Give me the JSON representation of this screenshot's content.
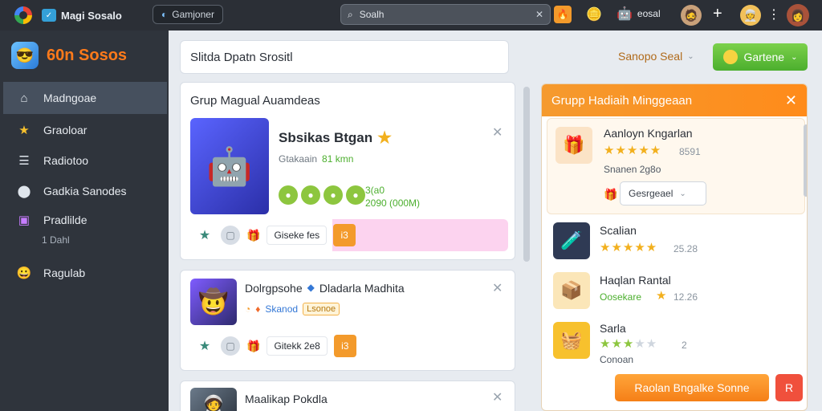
{
  "topbar": {
    "app_title": "Magi Sosalo",
    "tab_label": "Gamjoner",
    "search_value": "Soalh",
    "profile_label": "eosal"
  },
  "sidebar": {
    "brand_name": "60n Sosos",
    "items": [
      {
        "label": "Madngoae",
        "icon": "home-icon",
        "active": true
      },
      {
        "label": "Graoloar",
        "icon": "star-icon"
      },
      {
        "label": "Radiotoo",
        "icon": "list-icon"
      },
      {
        "label": "Gadkia Sanodes",
        "icon": "location-icon"
      },
      {
        "label": "Pradlilde",
        "icon": "gamepad-icon",
        "sub": "1 Dahl"
      },
      {
        "label": "Ragulab",
        "icon": "emoji-icon"
      }
    ]
  },
  "main": {
    "header": "Slitda Dpatn Srositl",
    "group_title": "Grup Magual Auamdeas",
    "cards": [
      {
        "title": "Sbsikas Btgan",
        "subtitle": "Gtakaain",
        "subtitle_accent": "81 kmn",
        "stat1": "3(a0",
        "stat2": "2090 (000M)",
        "tag": "Giseke fes",
        "button": "i3"
      },
      {
        "title": "Dolrgpsohe",
        "title2": "Dladarla Madhita",
        "meta": "Skanod",
        "tag_badge": "Lsonoe",
        "tag": "Gitekk 2e8",
        "button": "i3"
      },
      {
        "title": "Maalikap Pokdla"
      }
    ]
  },
  "right": {
    "filter_label": "Sanopo Seal",
    "green_button": "Gartene",
    "panel_title": "Grupp Hadiaih Minggeaan",
    "rewards": [
      {
        "name": "Aanloyn Kngarlan",
        "value": "8591",
        "sub": "Snanen 2g8o",
        "stars": 5
      },
      {
        "name": "Scalian",
        "value": "25.28",
        "stars": 5
      },
      {
        "name": "Haqlan Rantal",
        "value": "12.26",
        "sub_green": "Oosekare"
      },
      {
        "name": "Sarla",
        "value": "2",
        "sub": "Conoan",
        "stars_green": 3
      }
    ],
    "select_label": "Gesrgeael",
    "claim_button": "Raolan Bngalke Sonne",
    "red_button": "R"
  },
  "colors": {
    "accent_orange": "#f39a2b",
    "accent_green": "#4caf2e",
    "sidebar_bg": "#2f343c"
  }
}
